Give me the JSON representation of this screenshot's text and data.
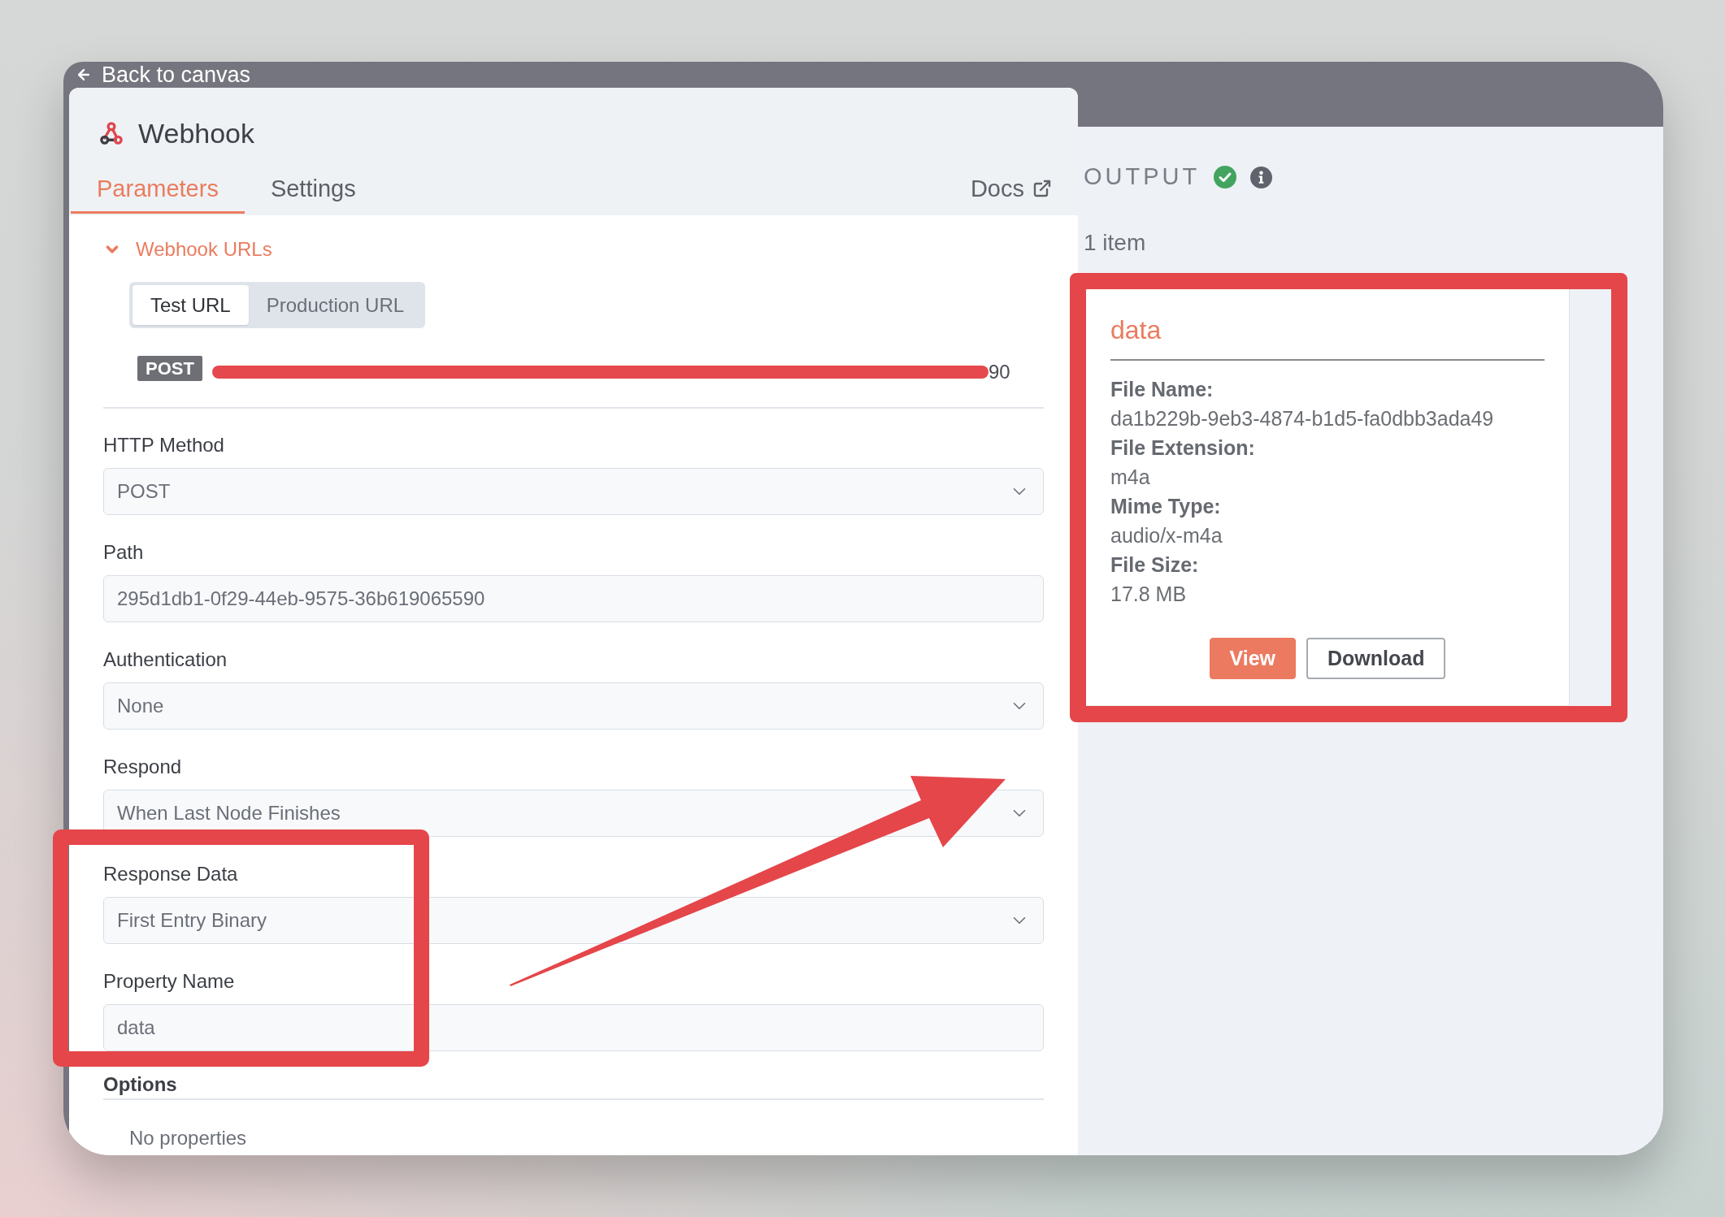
{
  "back_link": {
    "label": "Back to canvas"
  },
  "node": {
    "title": "Webhook"
  },
  "tabs": [
    {
      "label": "Parameters",
      "selected": true
    },
    {
      "label": "Settings",
      "selected": false
    }
  ],
  "docs_link": {
    "label": "Docs"
  },
  "webhook_urls": {
    "label": "Webhook URLs",
    "expanded": true,
    "url_options": [
      {
        "label": "Test URL",
        "selected": true
      },
      {
        "label": "Production URL",
        "selected": false
      }
    ],
    "method": "POST",
    "redacted": true,
    "url": "90"
  },
  "fields": [
    {
      "kind": "select",
      "label": "HTTP Method",
      "value": "POST"
    },
    {
      "kind": "text",
      "label": "Path",
      "value": "295d1db1-0f29-44eb-9575-36b619065590"
    },
    {
      "kind": "select",
      "label": "Authentication",
      "value": "None"
    },
    {
      "kind": "select",
      "label": "Respond",
      "value": "When Last Node Finishes"
    },
    {
      "kind": "select",
      "label": "Response Data",
      "value": "First Entry Binary"
    },
    {
      "kind": "text",
      "label": "Property Name",
      "value": "data"
    }
  ],
  "options": {
    "title": "Options",
    "empty_text": "No properties"
  },
  "output": {
    "title": "OUTPUT",
    "succeeded": true,
    "item_count": "1 item",
    "binary": {
      "title": "data",
      "properties": [
        {
          "label": "File Name:",
          "value": "da1b229b-9eb3-4874-b1d5-fa0dbb3ada49"
        },
        {
          "label": "File Extension:",
          "value": "m4a"
        },
        {
          "label": "Mime Type:",
          "value": "audio/x-m4a"
        },
        {
          "label": "File Size:",
          "value": "17.8 MB"
        }
      ],
      "buttons": [
        {
          "label": "View",
          "kind": "primary"
        },
        {
          "label": "Download",
          "kind": "secondary"
        }
      ]
    }
  }
}
